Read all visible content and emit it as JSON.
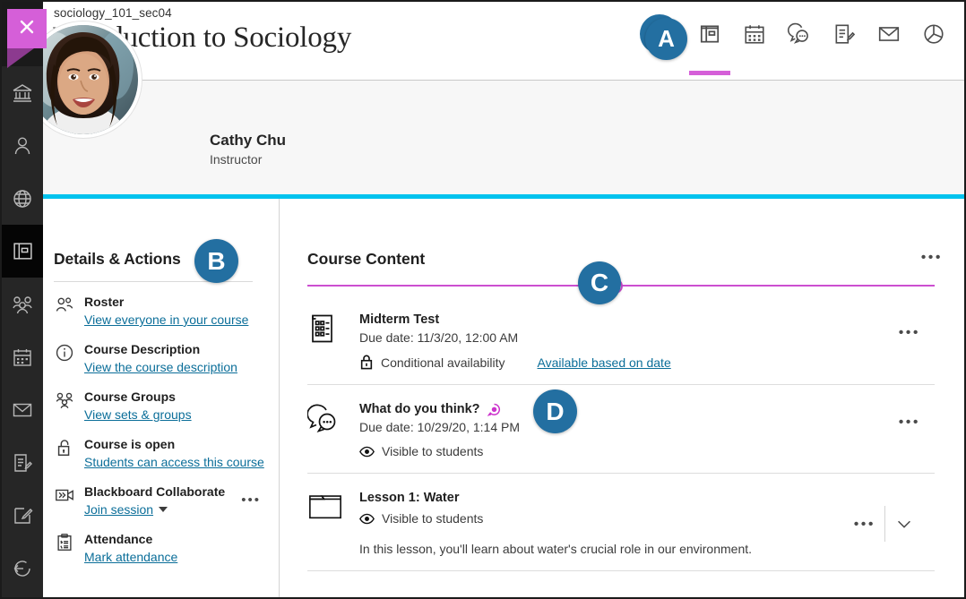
{
  "window": {
    "close_label": "×"
  },
  "rail": {
    "items": [
      {
        "name": "institution-page",
        "icon": "institution-icon"
      },
      {
        "name": "profile",
        "icon": "person-icon"
      },
      {
        "name": "activity-stream",
        "icon": "globe-icon"
      },
      {
        "name": "courses",
        "icon": "courses-book-icon",
        "active": true
      },
      {
        "name": "organizations",
        "icon": "people-group-icon"
      },
      {
        "name": "calendar",
        "icon": "calendar-icon"
      },
      {
        "name": "messages",
        "icon": "envelope-icon"
      },
      {
        "name": "grades",
        "icon": "grades-document-icon"
      },
      {
        "name": "tools",
        "icon": "pencil-square-icon"
      },
      {
        "name": "sign-out",
        "icon": "sign-out-icon"
      }
    ]
  },
  "header": {
    "course_id": "sociology_101_sec04",
    "course_title": "Introduction to Sociology",
    "nav": [
      {
        "label": "A",
        "icon": "user-avatar-letter",
        "selected": false
      },
      {
        "label": "Course Content",
        "icon": "content-book-icon",
        "selected": true
      },
      {
        "label": "Calendar",
        "icon": "calendar-icon",
        "selected": false
      },
      {
        "label": "Discussions",
        "icon": "discussion-bubbles-icon",
        "selected": false
      },
      {
        "label": "Gradebook",
        "icon": "gradebook-icon",
        "selected": false
      },
      {
        "label": "Messages",
        "icon": "envelope-icon",
        "selected": false
      },
      {
        "label": "Analytics",
        "icon": "pie-chart-icon",
        "selected": false
      }
    ]
  },
  "instructor": {
    "name": "Cathy Chu",
    "role": "Instructor"
  },
  "details": {
    "title": "Details & Actions",
    "rows": [
      {
        "icon": "roster-people-icon",
        "title": "Roster",
        "link": "View everyone in your course"
      },
      {
        "icon": "info-circle-icon",
        "title": "Course Description",
        "link": "View the course description"
      },
      {
        "icon": "groups-people-icon",
        "title": "Course Groups",
        "link": "View sets & groups"
      },
      {
        "icon": "open-lock-icon",
        "title": "Course is open",
        "link": "Students can access this course"
      },
      {
        "icon": "collaborate-video-icon",
        "title": "Blackboard Collaborate",
        "link": "Join session",
        "has_caret": true,
        "has_overflow": true,
        "overflow_label": "•••"
      },
      {
        "icon": "attendance-clipboard-icon",
        "title": "Attendance",
        "link": "Mark attendance"
      }
    ]
  },
  "course_content": {
    "title": "Course Content",
    "overflow_label": "•••",
    "add_label": "+",
    "items": [
      {
        "icon": "test-icon",
        "title": "Midterm Test",
        "subtitle": "Due date: 11/3/20, 12:00 AM",
        "status_icon": "lock-icon",
        "status": "Conditional availability",
        "status_link": "Available based on date",
        "overflow_label": "•••"
      },
      {
        "icon": "discussion-icon",
        "title": "What do you think?",
        "badge_icon": "discussion-badge-icon",
        "subtitle": "Due date: 10/29/20, 1:14 PM",
        "status_icon": "eye-icon",
        "status": "Visible to students",
        "overflow_label": "•••"
      },
      {
        "icon": "folder-icon",
        "title": "Lesson 1: Water",
        "status_icon": "eye-icon",
        "status": "Visible to students",
        "description": "In this lesson, you'll learn about water's crucial role in our environment.",
        "overflow_label": "•••",
        "expand_icon": "chevron-down-icon"
      }
    ]
  },
  "annotations": [
    {
      "id": "A",
      "label": "A"
    },
    {
      "id": "B",
      "label": "B"
    },
    {
      "id": "C",
      "label": "C"
    },
    {
      "id": "D",
      "label": "D"
    }
  ],
  "colors": {
    "accent_blue": "#236FA1",
    "accent_magenta": "#cc4fd0",
    "accent_cyan": "#00c3ee",
    "link": "#0b6e99",
    "rail_bg": "#262626",
    "close_tab": "#d55fd8"
  }
}
